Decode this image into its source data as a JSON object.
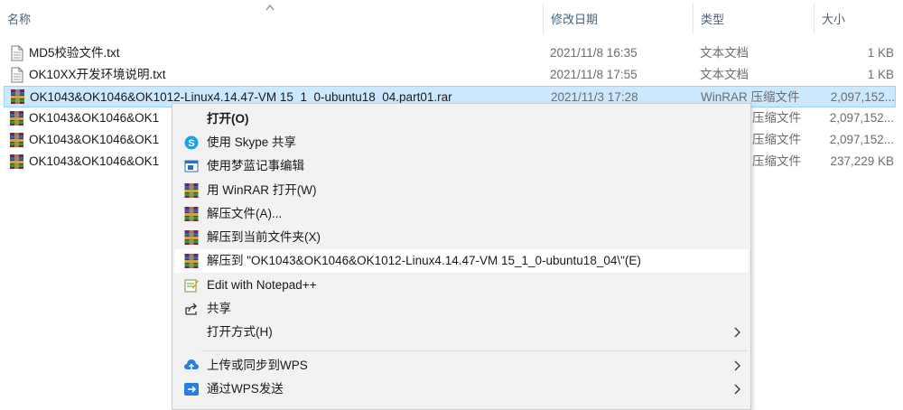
{
  "header": {
    "name": "名称",
    "date": "修改日期",
    "type": "类型",
    "size": "大小"
  },
  "files": [
    {
      "name": "MD5校验文件.txt",
      "date": "2021/11/8 16:35",
      "type": "文本文档",
      "size": "1 KB",
      "icon": "text-file-icon"
    },
    {
      "name": "OK10XX开发环境说明.txt",
      "date": "2021/11/8 17:55",
      "type": "文本文档",
      "size": "1 KB",
      "icon": "text-file-icon"
    },
    {
      "name": "OK1043&OK1046&OK1012-Linux4.14.47-VM 15_1_0-ubuntu18_04.part01.rar",
      "date": "2021/11/3 17:28",
      "type": "WinRAR 压缩文件",
      "size": "2,097,152...",
      "icon": "winrar-icon",
      "selected": true
    },
    {
      "name": "OK1043&OK1046&OK1",
      "date": "",
      "type": "压缩文件",
      "size": "2,097,152...",
      "icon": "winrar-icon"
    },
    {
      "name": "OK1043&OK1046&OK1",
      "date": "",
      "type": "压缩文件",
      "size": "2,097,152...",
      "icon": "winrar-icon"
    },
    {
      "name": "OK1043&OK1046&OK1",
      "date": "",
      "type": "压缩文件",
      "size": "237,229 KB",
      "icon": "winrar-icon"
    }
  ],
  "context_menu": {
    "items": [
      {
        "label": "打开(O)",
        "icon": "",
        "bold": true
      },
      {
        "label": "使用 Skype 共享",
        "icon": "skype-icon"
      },
      {
        "label": "使用梦蓝记事编辑",
        "icon": "editor-icon"
      },
      {
        "label": "用 WinRAR 打开(W)",
        "icon": "winrar-icon"
      },
      {
        "label": "解压文件(A)...",
        "icon": "winrar-icon"
      },
      {
        "label": "解压到当前文件夹(X)",
        "icon": "winrar-icon"
      },
      {
        "label": "解压到 \"OK1043&OK1046&OK1012-Linux4.14.47-VM 15_1_0-ubuntu18_04\\\"(E)",
        "icon": "winrar-icon",
        "hover": true
      },
      {
        "label": "Edit with Notepad++",
        "icon": "notepadpp-icon"
      },
      {
        "label": "共享",
        "icon": "share-icon"
      },
      {
        "label": "打开方式(H)",
        "icon": "",
        "submenu": true
      },
      {
        "label": "上传或同步到WPS",
        "icon": "wps-cloud-icon",
        "submenu": true
      },
      {
        "label": "通过WPS发送",
        "icon": "wps-send-icon",
        "submenu": true
      }
    ]
  },
  "colors": {
    "selection": "#cce8ff",
    "selection_border": "#99d1ff",
    "header_text": "#4c607a",
    "menu_bg": "#f2f2f2"
  }
}
